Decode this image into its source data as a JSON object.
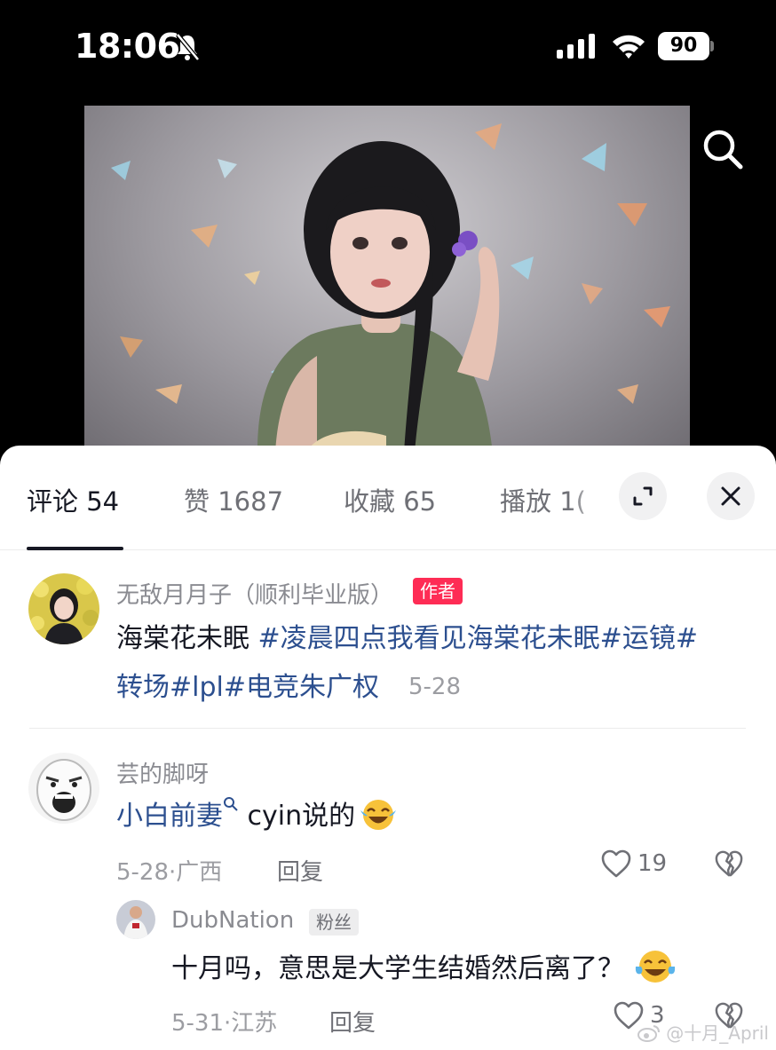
{
  "status_bar": {
    "time": "18:06",
    "battery": "90"
  },
  "tabs": [
    {
      "label": "评论 54"
    },
    {
      "label": "赞 1687"
    },
    {
      "label": "收藏 65"
    },
    {
      "label": "播放 1("
    }
  ],
  "comments": [
    {
      "username": "无敌月月子（顺利毕业版）",
      "badge": "作者",
      "text_plain": "海棠花未眠 ",
      "text_tags_line1": "#凌晨四点我看见海棠花未眠#运镜#",
      "text_tags_line2": "转场#lpl#电竞朱广权",
      "date": "5-28"
    },
    {
      "username": "芸的脚呀",
      "mention": "小白前妻",
      "text_after": " cyin说的",
      "date_location": "5-28·广西",
      "reply_label": "回复",
      "likes": "19"
    },
    {
      "username": "DubNation",
      "badge": "粉丝",
      "text": "十月吗，意思是大学生结婚然后离了？",
      "date_location": "5-31·江苏",
      "reply_label": "回复",
      "likes": "3"
    }
  ],
  "watermark": "@十月_April",
  "colors": {
    "accent": "#fe2c55",
    "link": "#2c4f8f",
    "muted": "#9c9da2"
  }
}
